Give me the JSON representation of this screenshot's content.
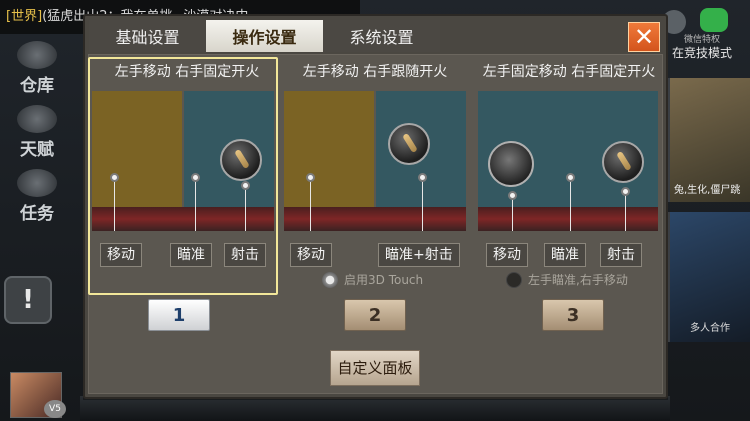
{
  "background": {
    "chat": {
      "tag": "[世界]",
      "text": "(猛虎出山2：我在单挑~沙漠对决中"
    },
    "left_menu": [
      {
        "label": "仓库",
        "icon": "warehouse-icon"
      },
      {
        "label": "天赋",
        "icon": "talent-icon"
      },
      {
        "label": "任务",
        "icon": "mission-icon"
      }
    ],
    "alert_glyph": "!",
    "vip_label": "V5",
    "right_text": "在竞技模式",
    "wechat_label": "微信特权",
    "right_cards": [
      "兔,生化,僵尸跳",
      "多人合作"
    ]
  },
  "modal": {
    "tabs": [
      {
        "label": "基础设置",
        "active": false
      },
      {
        "label": "操作设置",
        "active": true
      },
      {
        "label": "系统设置",
        "active": false
      }
    ],
    "close_glyph": "✕",
    "layouts": [
      {
        "title": "左手移动 右手固定开火",
        "labels": [
          "移动",
          "瞄准",
          "射击"
        ],
        "number": "1",
        "selected": true
      },
      {
        "title": "左手移动 右手跟随开火",
        "labels": [
          "移动",
          "瞄准+射击"
        ],
        "option": {
          "label": "启用3D Touch",
          "checked": true
        },
        "number": "2",
        "selected": false
      },
      {
        "title": "左手固定移动 右手固定开火",
        "labels": [
          "移动",
          "瞄准",
          "射击"
        ],
        "option": {
          "label": "左手瞄准,右手移动",
          "checked": false
        },
        "number": "3",
        "selected": false
      }
    ],
    "custom_button": "自定义面板"
  },
  "colors": {
    "move_zone": "#7b6324",
    "aim_zone": "#345861",
    "close_button": "#e4662b",
    "selected_frame": "#f2e79a"
  }
}
